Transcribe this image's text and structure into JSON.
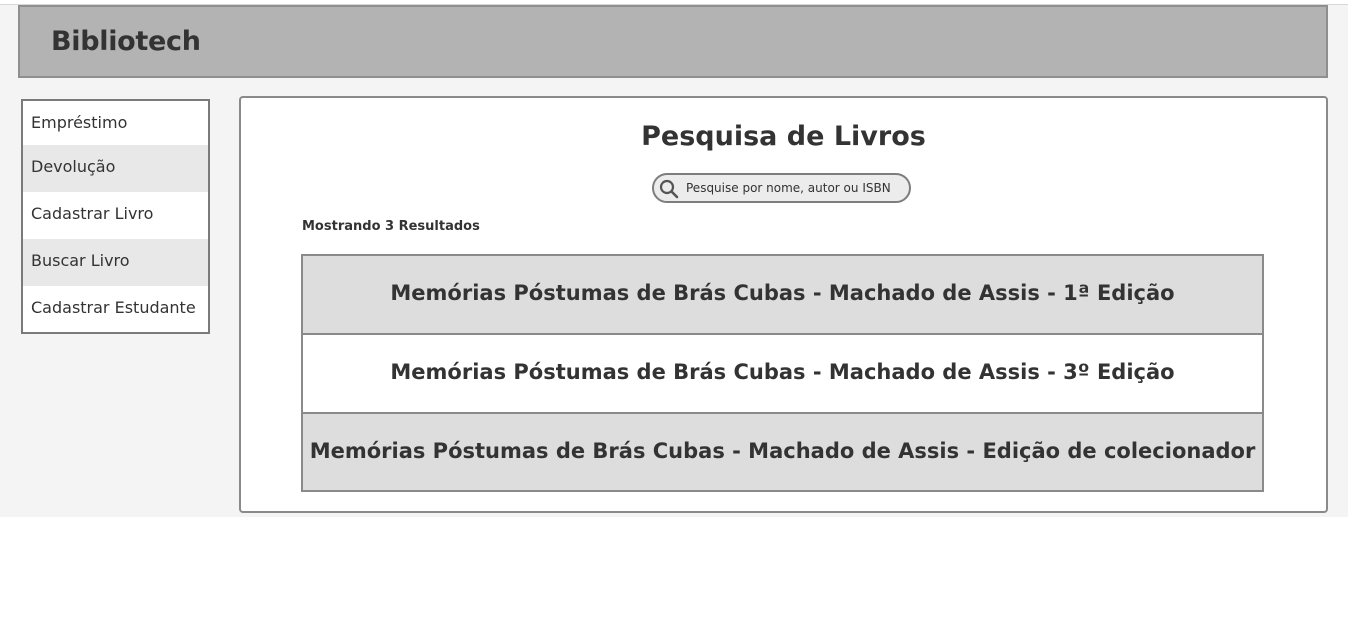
{
  "app": {
    "title": "Bibliotech"
  },
  "sidebar": {
    "items": [
      {
        "label": "Empréstimo"
      },
      {
        "label": "Devolução"
      },
      {
        "label": "Cadastrar Livro"
      },
      {
        "label": "Buscar Livro"
      },
      {
        "label": "Cadastrar Estudante"
      }
    ]
  },
  "main": {
    "title": "Pesquisa de Livros",
    "search": {
      "placeholder": "Pesquise por nome, autor ou ISBN",
      "value": "",
      "icon": "search-icon"
    },
    "results_label": "Mostrando 3 Resultados",
    "results": [
      {
        "label": "Memórias Póstumas de Brás Cubas - Machado de Assis - 1ª Edição"
      },
      {
        "label": "Memórias Póstumas de Brás Cubas - Machado de Assis - 3º Edição"
      },
      {
        "label": "Memórias Póstumas de Brás Cubas - Machado de Assis - Edição de colecionador"
      }
    ]
  },
  "colors": {
    "header_bg": "#b3b3b3",
    "page_bg": "#f4f4f4",
    "row_shade": "#dddddd",
    "text": "#333333"
  }
}
